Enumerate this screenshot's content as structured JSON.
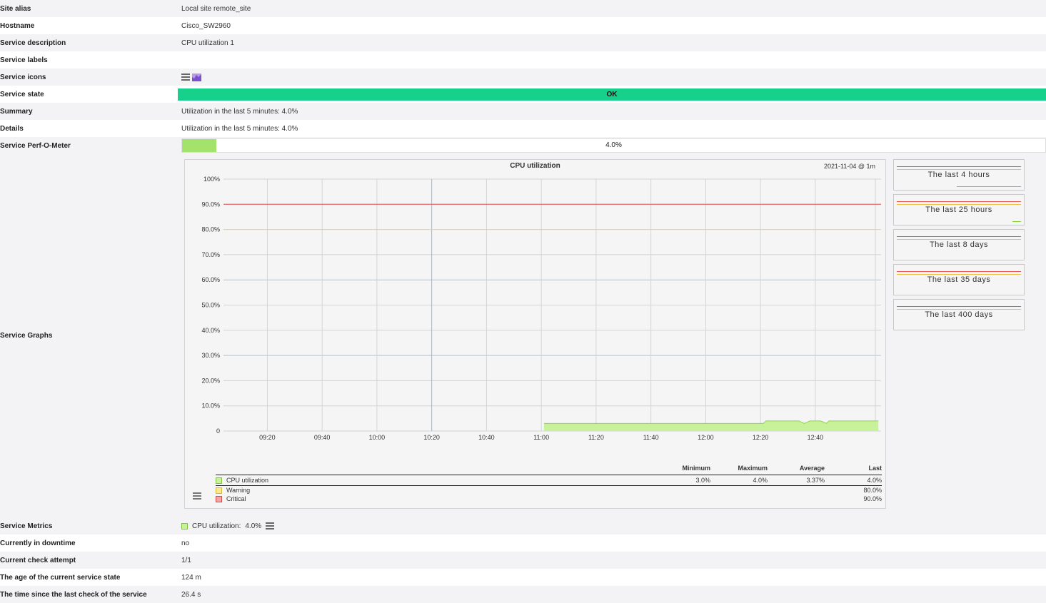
{
  "rows": {
    "site_alias": {
      "label": "Site alias",
      "value": "Local site remote_site"
    },
    "hostname": {
      "label": "Hostname",
      "value": "Cisco_SW2960"
    },
    "service_description": {
      "label": "Service description",
      "value": "CPU utilization 1"
    },
    "service_labels": {
      "label": "Service labels",
      "value": ""
    },
    "service_icons": {
      "label": "Service icons",
      "icons": [
        "menu-icon",
        "graph-icon"
      ]
    },
    "service_state": {
      "label": "Service state",
      "value": "OK",
      "color": "#16d08b"
    },
    "summary": {
      "label": "Summary",
      "value": "Utilization in the last 5 minutes: 4.0%"
    },
    "details": {
      "label": "Details",
      "value": "Utilization in the last 5 minutes: 4.0%"
    },
    "perf_o_meter": {
      "label": "Service Perf-O-Meter",
      "value": "4.0%",
      "fraction": 0.04,
      "color": "#a3e36b"
    },
    "service_graphs": {
      "label": "Service Graphs"
    },
    "service_metrics": {
      "label": "Service Metrics",
      "metric_name": "CPU utilization:",
      "metric_value": "4.0%"
    },
    "downtime": {
      "label": "Currently in downtime",
      "value": "no"
    },
    "check_attempt": {
      "label": "Current check attempt",
      "value": "1/1"
    },
    "state_age": {
      "label": "The age of the current service state",
      "value": "124 m"
    },
    "last_check": {
      "label": "The time since the last check of the service",
      "value": "26.4 s"
    }
  },
  "graph": {
    "title": "CPU utilization",
    "range_label": "2021-11-04 @ 1m",
    "legend_headers": [
      "Minimum",
      "Maximum",
      "Average",
      "Last"
    ],
    "legend": [
      {
        "name": "CPU utilization",
        "color": "#a3e36b",
        "min": "3.0%",
        "max": "4.0%",
        "avg": "3.37%",
        "last": "4.0%"
      },
      {
        "name": "Warning",
        "color": "#f2d96a",
        "last": "80.0%"
      },
      {
        "name": "Critical",
        "color": "#f08a8a",
        "last": "90.0%"
      }
    ]
  },
  "chart_data": {
    "type": "area",
    "title": "CPU utilization",
    "xlabel": "",
    "ylabel": "",
    "ylim": [
      0,
      100
    ],
    "y_ticks": [
      "0",
      "10.0%",
      "20.0%",
      "30.0%",
      "40.0%",
      "50.0%",
      "60.0%",
      "70.0%",
      "80.0%",
      "90.0%",
      "100%"
    ],
    "x_ticks": [
      "09:20",
      "09:40",
      "10:00",
      "10:20",
      "10:40",
      "11:00",
      "11:20",
      "11:40",
      "12:00",
      "12:20",
      "12:40"
    ],
    "x_range_minutes": [
      544,
      784
    ],
    "grid": true,
    "series": [
      {
        "name": "CPU utilization",
        "color": "#a3e36b",
        "x": [
          661,
          700,
          741,
          742,
          753,
          754,
          756,
          758,
          760,
          762,
          764,
          765,
          783
        ],
        "y": [
          3,
          3,
          3,
          4,
          4,
          4,
          3,
          4,
          4,
          4,
          3,
          4,
          4
        ]
      }
    ],
    "thresholds": [
      {
        "name": "Warning",
        "value": 80,
        "color": "#f2d96a"
      },
      {
        "name": "Critical",
        "value": 90,
        "color": "#e85555"
      }
    ]
  },
  "thumbnails": [
    {
      "label": "The last 4 hours"
    },
    {
      "label": "The last 25 hours"
    },
    {
      "label": "The last 8 days"
    },
    {
      "label": "The last 35 days"
    },
    {
      "label": "The last 400 days"
    }
  ]
}
